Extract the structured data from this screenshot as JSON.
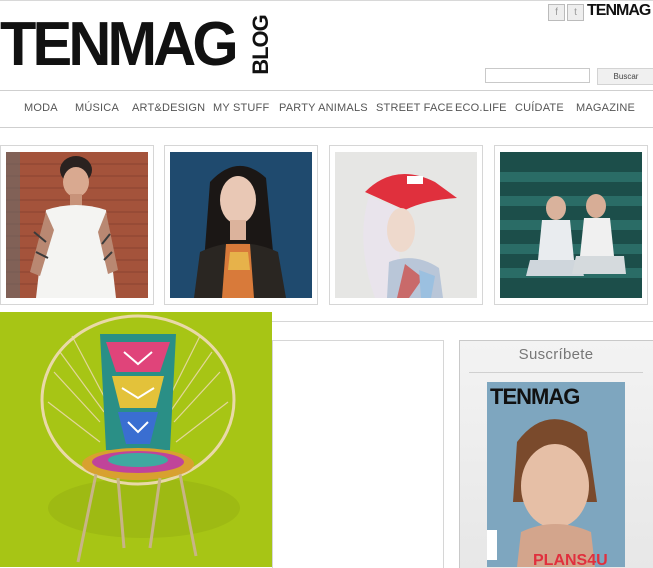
{
  "header": {
    "logo_text": "TENMAG",
    "logo_blog": "BLOG",
    "mini_logo": "TENMAG",
    "social": [
      {
        "icon": "facebook-icon",
        "glyph": "f"
      },
      {
        "icon": "twitter-icon",
        "glyph": "t"
      }
    ],
    "search_placeholder": "",
    "search_button": "Buscar"
  },
  "nav": {
    "items": [
      "MODA",
      "MÚSICA",
      "ART&DESIGN",
      "MY STUFF",
      "PARTY ANIMALS",
      "STREET FACE",
      "ECO.LIFE",
      "CUÍDATE",
      "MAGAZINE"
    ]
  },
  "photos": [
    {
      "name": "tattooed-man-photo"
    },
    {
      "name": "woman-dark-hair-photo"
    },
    {
      "name": "red-cap-model-photo"
    },
    {
      "name": "two-men-stairs-photo"
    }
  ],
  "subscribe": {
    "title": "Suscríbete",
    "magazine_masthead": "TENMAG",
    "magazine_cover_text": "PLANS4U"
  },
  "colors": {
    "chair_bg": "#a7c515",
    "cap_red": "#e0303d"
  }
}
